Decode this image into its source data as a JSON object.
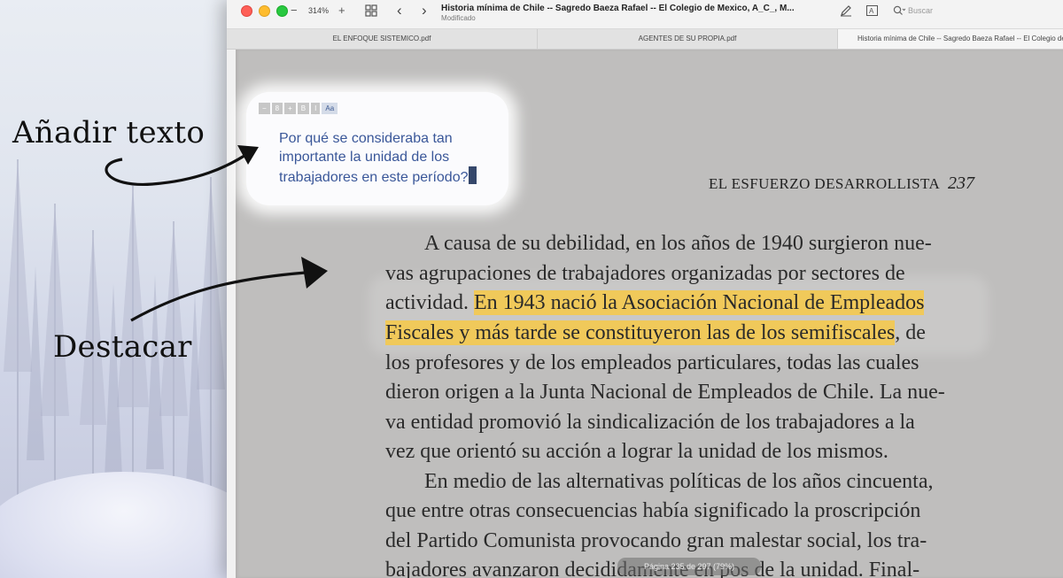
{
  "callouts": {
    "add_text": "Añadir texto",
    "highlight": "Destacar"
  },
  "window": {
    "title": "Historia mínima de Chile -- Sagredo Baeza Rafael -- El Colegio de Mexico, A_C_, M...",
    "subtitle": "Modificado",
    "zoom": "314%",
    "zoom_minus": "−",
    "zoom_plus": "+",
    "search_placeholder": "Buscar"
  },
  "tabs": [
    {
      "label": "EL ENFOQUE SISTEMICO.pdf"
    },
    {
      "label": "AGENTES DE SU PROPIA.pdf"
    },
    {
      "label": "Historia mínima de Chile -- Sagredo Baeza Rafael -- El Colegio de Mexico, A_C_, M..."
    }
  ],
  "annotation": {
    "toolbar": {
      "minus": "−",
      "size": "8",
      "plus": "+",
      "bold": "B",
      "italic": "I",
      "font": "Aa"
    },
    "text": "Por qué se consideraba tan importante la unidad de los trabajadores en este período?"
  },
  "page": {
    "running_head": "EL ESFUERZO DESARROLLISTA",
    "number": "237",
    "lines": {
      "l1": "A causa de su debilidad, en los años de 1940 surgieron nue-",
      "l2": "vas agrupaciones de trabajadores organizadas por sectores de",
      "l3_pre": "actividad. ",
      "l3_hl": "En 1943 nació la Asociación Nacional de Empleados",
      "l4_hl": "Fiscales y más tarde se constituyeron las de los semifiscales",
      "l4_post": ", de",
      "l5": "los profesores y de los empleados particulares, todas las cuales",
      "l6": "dieron origen a la Junta Nacional de Empleados de Chile. La nue-",
      "l7": "va entidad promovió la sindicalización de los trabajadores a la",
      "l8": "vez que orientó su acción a lograr la unidad de los mismos.",
      "l9": "En medio de las alternativas políticas de los años cincuenta,",
      "l10": "que entre otras consecuencias había significado la proscripción",
      "l11": "del Partido Comunista provocando gran malestar social, los tra-",
      "l12": "bajadores avanzaron decididamente en pos de la unidad. Final-"
    },
    "highlight_color": "#f0c95a",
    "indicator": "Página 235 de 297 (79%)"
  }
}
